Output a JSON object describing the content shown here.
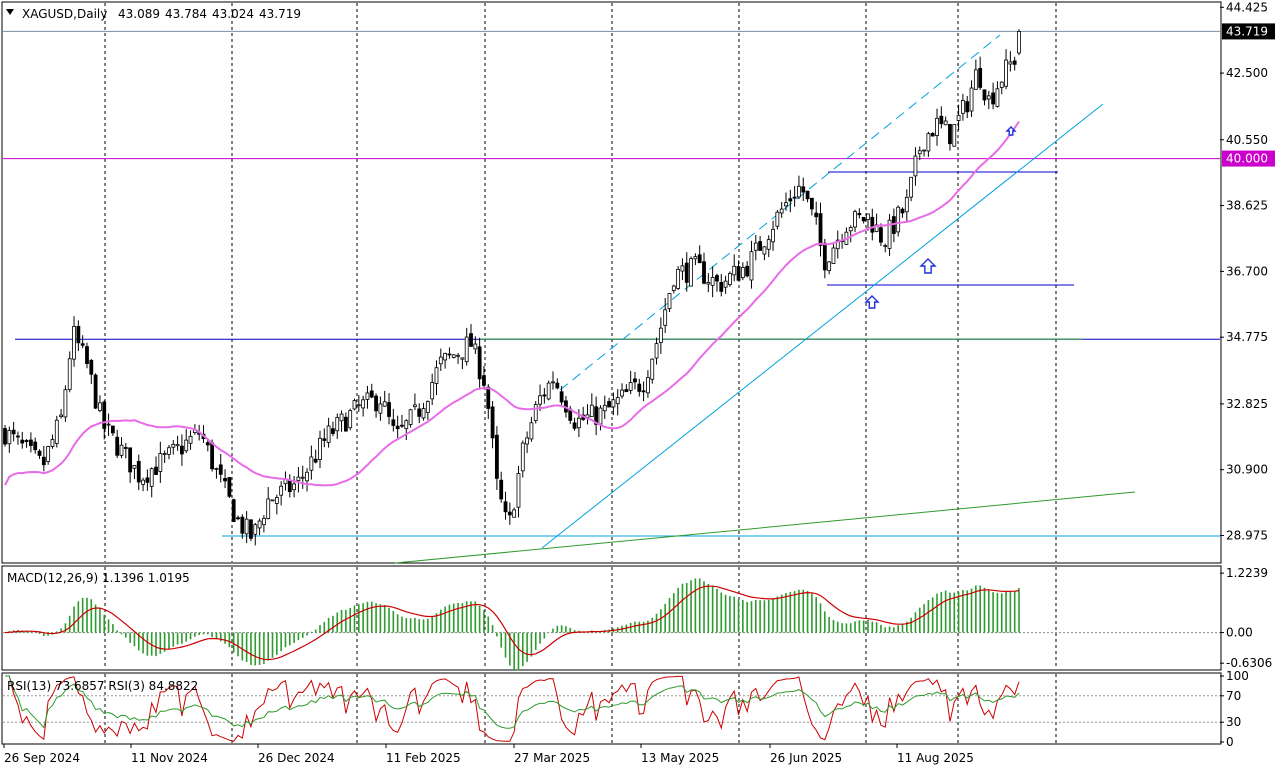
{
  "chart_data": {
    "type": "candlestick",
    "main": {
      "header": {
        "symbol": "XAGUSD,Daily",
        "ohlc": [
          "43.089",
          "43.784",
          "43.024",
          "43.719"
        ]
      },
      "price_axis_labels": [
        "44.425",
        "42.500",
        "40.550",
        "38.625",
        "36.700",
        "34.775",
        "32.825",
        "30.900",
        "28.975"
      ],
      "ylim": [
        28.2,
        44.55
      ],
      "current_price_label": "43.719",
      "current_price": 43.719,
      "level_label": "40.000",
      "level": 40.0,
      "moving_average_color": "#e86be8",
      "up_color": "#000000",
      "down_color": "#000000"
    },
    "macd": {
      "label": "MACD(12,26,9) 1.1396 1.0195",
      "axis_labels": [
        "1.2239",
        "0.00",
        "-0.6306"
      ],
      "ylim": [
        -0.75,
        1.35
      ],
      "histogram_color": "#2e9b2e",
      "signal_color": "#cc0000"
    },
    "rsi": {
      "label": "RSI(13) 73.6857  RSI(3) 84.8822",
      "axis_labels": [
        "100",
        "70",
        "30",
        "0"
      ],
      "ylim": [
        0,
        100
      ],
      "rsi13_color": "#2e9b2e",
      "rsi3_color": "#cc0000"
    },
    "x_axis_labels": [
      "26 Sep 2024",
      "11 Nov 2024",
      "26 Dec 2024",
      "11 Feb 2025",
      "27 Mar 2025",
      "13 May 2025",
      "26 Jun 2025",
      "11 Aug 2025"
    ],
    "grid": "vertical dashed",
    "colors": {
      "blue_level": "#0000cc",
      "light_blue_line": "#00a0e0",
      "green_trend": "#2e9b2e",
      "magenta_level": "#cc00cc",
      "arrow": "#1c2fd6"
    }
  }
}
